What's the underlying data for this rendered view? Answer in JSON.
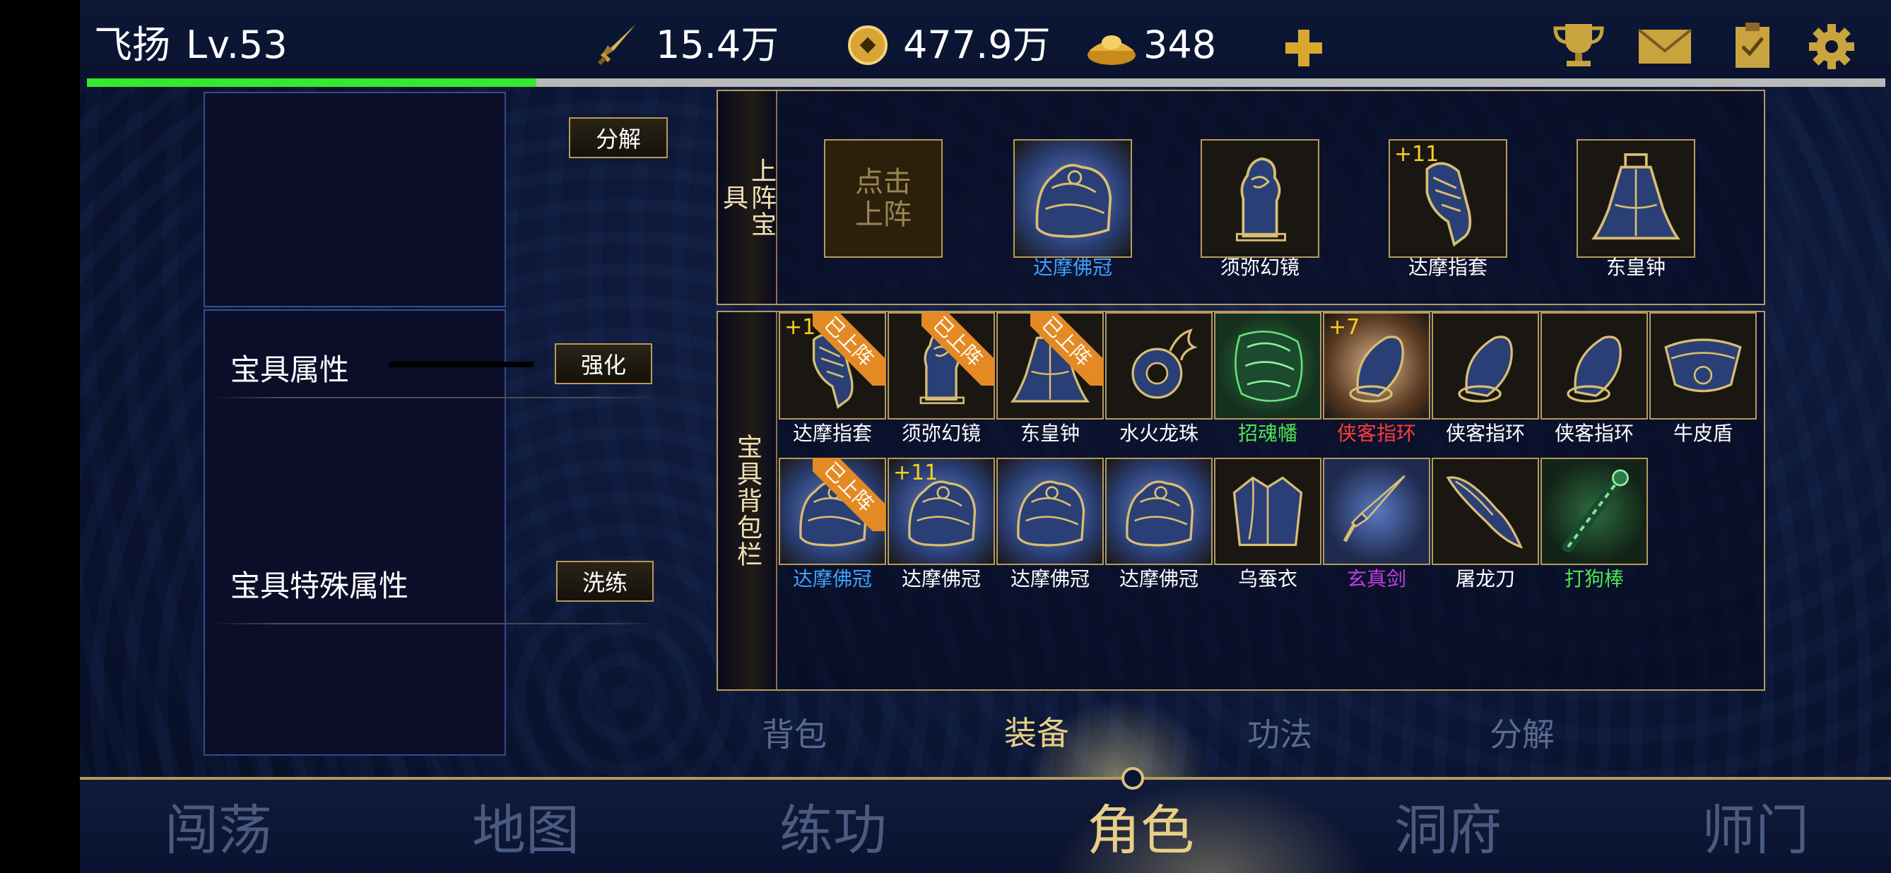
{
  "player": {
    "name": "飞扬",
    "level": "Lv.53",
    "xp_fraction": 0.25
  },
  "currencies": [
    {
      "icon": "sword-icon",
      "value": "15.4万"
    },
    {
      "icon": "coin-icon",
      "value": "477.9万"
    },
    {
      "icon": "ingot-icon",
      "value": "348"
    }
  ],
  "top_icons": [
    "plus-icon",
    "trophy-icon",
    "mail-icon",
    "quest-clipboard-icon",
    "settings-gear-icon"
  ],
  "left": {
    "decompose_button": "分解",
    "attr_title": "宝具属性",
    "strengthen_button": "强化",
    "special_title": "宝具特殊属性",
    "refine_button": "洗练"
  },
  "equip_section": {
    "label": "上阵宝具",
    "empty_slot_text": "点击上阵",
    "slots": [
      {
        "name": "达摩佛冠",
        "color": "#3fa3ff",
        "enh": "",
        "icon": "buddha-crown-icon"
      },
      {
        "name": "须弥幻镜",
        "color": "#ffffff",
        "enh": "",
        "icon": "mirror-stone-icon"
      },
      {
        "name": "达摩指套",
        "color": "#ffffff",
        "enh": "+11",
        "icon": "finger-glove-icon"
      },
      {
        "name": "东皇钟",
        "color": "#ffffff",
        "enh": "",
        "icon": "bell-icon"
      }
    ]
  },
  "bag_section": {
    "label": "宝具背包栏",
    "equipped_tag": "已上阵",
    "items": [
      {
        "name": "达摩指套",
        "color": "#ffffff",
        "enh": "+1",
        "equipped": true,
        "icon": "finger-glove-icon"
      },
      {
        "name": "须弥幻镜",
        "color": "#ffffff",
        "enh": "",
        "equipped": true,
        "icon": "mirror-stone-icon"
      },
      {
        "name": "东皇钟",
        "color": "#ffffff",
        "enh": "",
        "equipped": true,
        "icon": "bell-icon"
      },
      {
        "name": "水火龙珠",
        "color": "#ffffff",
        "enh": "",
        "equipped": false,
        "icon": "dragon-pearl-icon"
      },
      {
        "name": "招魂幡",
        "color": "#4ee44e",
        "enh": "",
        "equipped": false,
        "icon": "soul-banner-icon"
      },
      {
        "name": "侠客指环",
        "color": "#ff3b3b",
        "enh": "+7",
        "equipped": false,
        "icon": "ring-icon"
      },
      {
        "name": "侠客指环",
        "color": "#ffffff",
        "enh": "",
        "equipped": false,
        "icon": "ring-icon"
      },
      {
        "name": "侠客指环",
        "color": "#ffffff",
        "enh": "",
        "equipped": false,
        "icon": "ring-icon"
      },
      {
        "name": "牛皮盾",
        "color": "#ffffff",
        "enh": "",
        "equipped": false,
        "icon": "shield-icon"
      },
      {
        "name": "达摩佛冠",
        "color": "#3fa3ff",
        "enh": "",
        "equipped": true,
        "icon": "buddha-crown-icon"
      },
      {
        "name": "达摩佛冠",
        "color": "#ffffff",
        "enh": "+11",
        "equipped": false,
        "icon": "buddha-crown-icon"
      },
      {
        "name": "达摩佛冠",
        "color": "#ffffff",
        "enh": "",
        "equipped": false,
        "icon": "buddha-crown-icon"
      },
      {
        "name": "达摩佛冠",
        "color": "#ffffff",
        "enh": "",
        "equipped": false,
        "icon": "buddha-crown-icon"
      },
      {
        "name": "乌蚕衣",
        "color": "#ffffff",
        "enh": "",
        "equipped": false,
        "icon": "silk-robe-icon"
      },
      {
        "name": "玄真剑",
        "color": "#c43ce0",
        "enh": "",
        "equipped": false,
        "icon": "sword-icon"
      },
      {
        "name": "屠龙刀",
        "color": "#ffffff",
        "enh": "",
        "equipped": false,
        "icon": "dragon-blade-icon"
      },
      {
        "name": "打狗棒",
        "color": "#4ee44e",
        "enh": "",
        "equipped": false,
        "icon": "staff-icon"
      }
    ]
  },
  "sub_tabs": [
    {
      "label": "背包",
      "active": false
    },
    {
      "label": "装备",
      "active": true
    },
    {
      "label": "功法",
      "active": false
    },
    {
      "label": "分解",
      "active": false
    }
  ],
  "bottom_nav": [
    {
      "label": "闯荡",
      "active": false
    },
    {
      "label": "地图",
      "active": false
    },
    {
      "label": "练功",
      "active": false
    },
    {
      "label": "角色",
      "active": true
    },
    {
      "label": "洞府",
      "active": false
    },
    {
      "label": "师门",
      "active": false
    }
  ],
  "colors": {
    "gold": "#b89a5a",
    "active_tab": "#e8cf86",
    "xp": "#34ea2c"
  }
}
